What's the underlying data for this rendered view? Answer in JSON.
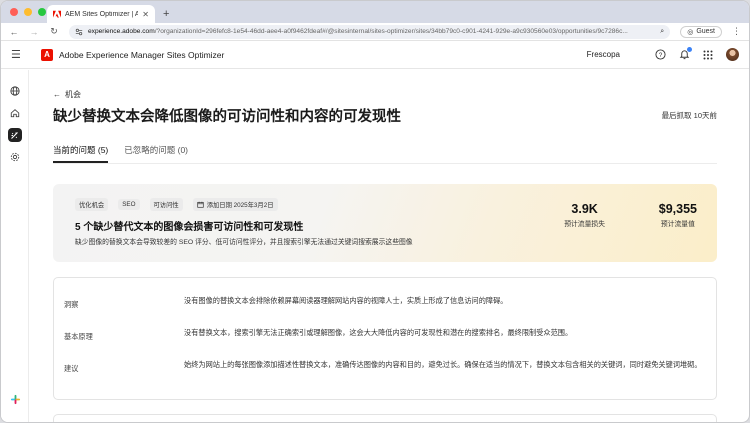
{
  "browser": {
    "tab_title": "AEM Sites Optimizer | Adob",
    "new_tab": "+",
    "url_host": "experience.adobe.com",
    "url_rest": "/?organizationId=296fefc8-1e54-46dd-aee4-a0f9462fdeaf#/@sitesinternal/sites-optimizer/sites/34bb79c0-c901-4241-929e-a9c930560e03/opportunities/9c7286c...",
    "guest_label": "Guest"
  },
  "app": {
    "name": "Adobe Experience Manager Sites Optimizer",
    "org": "Frescopa"
  },
  "page": {
    "back_label": "机会",
    "title": "缺少替换文本会降低图像的可访问性和内容的可发现性",
    "updated": "最后抓取 10天前",
    "tabs": [
      {
        "label": "当前的问题 (5)"
      },
      {
        "label": "已忽略的问题 (0)"
      }
    ]
  },
  "hero": {
    "tags": [
      "优化机会",
      "SEO",
      "可访问性"
    ],
    "date": "添加日期 2025年3月2日",
    "headline": "5 个缺少替代文本的图像会损害可访问性和可发现性",
    "description": "缺少图像的替换文本会导致较差的 SEO 评分、低可访问性评分，并且搜索引擎无法通过关键词搜索展示这些图像",
    "stats": [
      {
        "value": "3.9K",
        "label": "预计流量损失"
      },
      {
        "value": "$9,355",
        "label": "预计流量值"
      }
    ]
  },
  "details": [
    {
      "key": "洞察",
      "text": "没有图像的替换文本会排除依赖屏幕阅读器理解网站内容的视障人士，实质上形成了信息访问的障碍。"
    },
    {
      "key": "基本原理",
      "text": "没有替换文本，搜索引擎无法正确索引或理解图像，这会大大降低内容的可发现性和潜在的搜索排名，最终限制受众范围。"
    },
    {
      "key": "建议",
      "text": "始终为网站上的每张图像添加描述性替换文本，准确传达图像的内容和目的，避免过长。确保在适当的情况下，替换文本包含相关的关键词，同时避免关键词堆砌。"
    }
  ]
}
